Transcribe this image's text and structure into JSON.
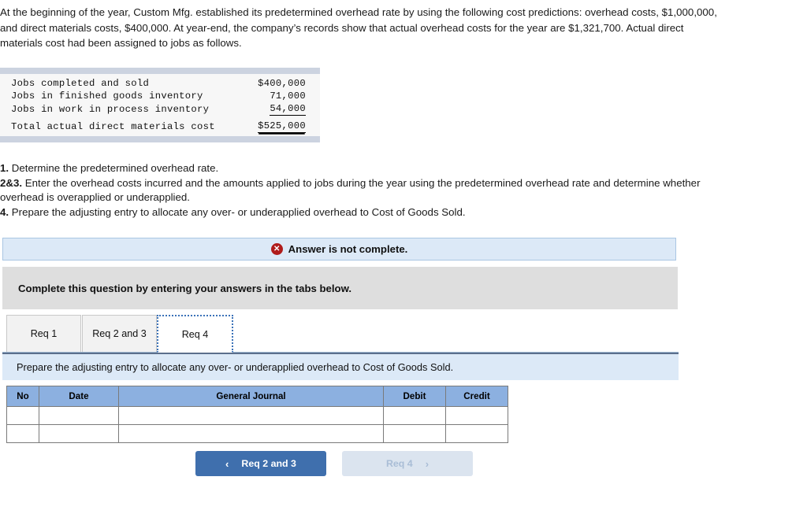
{
  "problem": {
    "text": "At the beginning of the year, Custom Mfg. established its predetermined overhead rate by using the following cost predictions: overhead costs, $1,000,000, and direct materials costs, $400,000. At year-end, the company’s records show that actual overhead costs for the year are $1,321,700. Actual direct materials cost had been assigned to jobs as follows."
  },
  "cost_table": {
    "rows": [
      {
        "label": "Jobs completed and sold",
        "amount": "$400,000",
        "rule": "none"
      },
      {
        "label": "Jobs in finished goods inventory",
        "amount": "71,000",
        "rule": "none"
      },
      {
        "label": "Jobs in work in process inventory",
        "amount": "54,000",
        "rule": "single"
      },
      {
        "label": "Total actual direct materials cost",
        "amount": "$525,000",
        "rule": "double"
      }
    ]
  },
  "requirements": {
    "item1_num": "1.",
    "item1_text": " Determine the predetermined overhead rate.",
    "item2_num": "2&3.",
    "item2_text": " Enter the overhead costs incurred and the amounts applied to jobs during the year using the predetermined overhead rate and determine whether overhead is overapplied or underapplied.",
    "item4_num": "4.",
    "item4_text": " Prepare the adjusting entry to allocate any over- or underapplied overhead to Cost of Goods Sold."
  },
  "banner": {
    "icon": "error-x-icon",
    "icon_glyph": "✕",
    "text": "Answer is not complete."
  },
  "instruction": {
    "text": "Complete this question by entering your answers in the tabs below."
  },
  "tabs": [
    {
      "label": "Req 1",
      "active": false
    },
    {
      "label": "Req 2 and 3",
      "active": false
    },
    {
      "label": "Req 4",
      "active": true
    }
  ],
  "sub_instruction": {
    "text": "Prepare the adjusting entry to allocate any over- or underapplied overhead to Cost of Goods Sold."
  },
  "journal": {
    "headers": [
      "No",
      "Date",
      "General Journal",
      "Debit",
      "Credit"
    ],
    "rows": [
      [
        "",
        "",
        "",
        "",
        ""
      ],
      [
        "",
        "",
        "",
        "",
        ""
      ]
    ]
  },
  "nav": {
    "prev_label": "Req 2 and 3",
    "prev_chevron": "‹",
    "next_label": "Req 4",
    "next_chevron": "›"
  },
  "colors": {
    "banner_bg": "#dce9f7",
    "banner_border": "#a9c6e3",
    "grey_strip": "#dedede",
    "table_header_blue": "#8cb0e0",
    "primary_button": "#3f6fad",
    "disabled_button": "#dbe4ef",
    "error_red": "#b01b1b",
    "cost_band": "#ccd3e0"
  }
}
